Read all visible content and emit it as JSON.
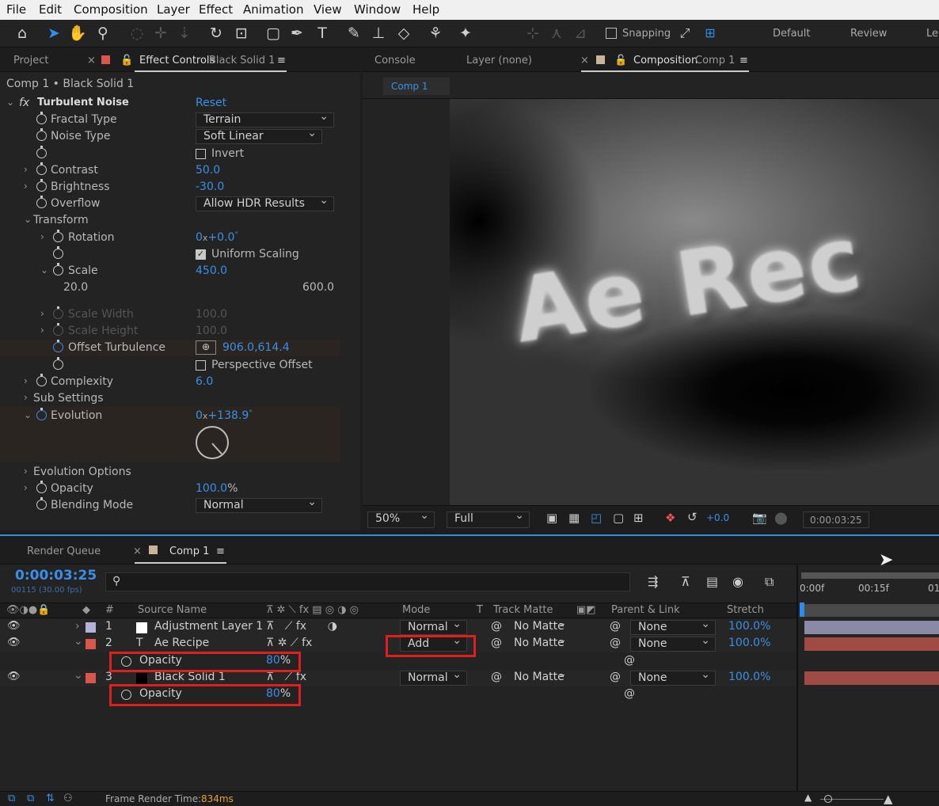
{
  "menu": [
    "File",
    "Edit",
    "Composition",
    "Layer",
    "Effect",
    "Animation",
    "View",
    "Window",
    "Help"
  ],
  "toolbar": {
    "snapping": "Snapping",
    "workspaces": [
      "Default",
      "Review",
      "Le"
    ]
  },
  "left_panel": {
    "tabs": {
      "project": "Project",
      "effect_controls": "Effect Controls",
      "layer": "Black Solid 1"
    },
    "breadcrumb": "Comp 1 • Black Solid 1",
    "effect": {
      "name": "Turbulent Noise",
      "reset": "Reset",
      "fx": "fx"
    },
    "props": {
      "fractal_type": {
        "label": "Fractal Type",
        "value": "Terrain"
      },
      "noise_type": {
        "label": "Noise Type",
        "value": "Soft Linear"
      },
      "invert": "Invert",
      "contrast": {
        "label": "Contrast",
        "value": "50.0"
      },
      "brightness": {
        "label": "Brightness",
        "value": "-30.0"
      },
      "overflow": {
        "label": "Overflow",
        "value": "Allow HDR Results"
      },
      "transform": "Transform",
      "rotation": {
        "label": "Rotation",
        "v1": "0",
        "v2": "+0.0"
      },
      "uniform_scaling": "Uniform Scaling",
      "scale": {
        "label": "Scale",
        "value": "450.0",
        "min": "20.0",
        "max": "600.0",
        "level": 0.74
      },
      "scale_width": {
        "label": "Scale Width",
        "value": "100.0"
      },
      "scale_height": {
        "label": "Scale Height",
        "value": "100.0"
      },
      "offset": {
        "label": "Offset Turbulence",
        "value": "906.0,614.4"
      },
      "perspective": "Perspective Offset",
      "complexity": {
        "label": "Complexity",
        "value": "6.0"
      },
      "sub_settings": "Sub Settings",
      "evolution": {
        "label": "Evolution",
        "v1": "0",
        "v2": "+138.9"
      },
      "evolution_options": "Evolution Options",
      "opacity": {
        "label": "Opacity",
        "value": "100.0",
        "unit": "%"
      },
      "blending": {
        "label": "Blending Mode",
        "value": "Normal"
      }
    }
  },
  "viewer": {
    "tabs": {
      "console": "Console",
      "layer": "Layer (none)",
      "composition": "Composition",
      "comp": "Comp 1"
    },
    "comp_tab": "Comp 1",
    "zoom": "50%",
    "resolution": "Full",
    "exposure": "+0.0",
    "timecode": "0:00:03:25"
  },
  "timeline": {
    "tabs": {
      "render_queue": "Render Queue",
      "comp": "Comp 1"
    },
    "timecode": "0:00:03:25",
    "frames": "00115 (30.00 fps)",
    "search_placeholder": "",
    "headers": {
      "num": "#",
      "source": "Source Name",
      "mode": "Mode",
      "t": "T",
      "track_matte": "Track Matte",
      "parent": "Parent & Link",
      "stretch": "Stretch"
    },
    "ruler": [
      "0:00f",
      "00:15f",
      "01"
    ],
    "layers": [
      {
        "num": "1",
        "name": "Adjustment Layer 1",
        "mode": "Normal",
        "matte": "No Matte",
        "parent": "None",
        "stretch": "100.0%",
        "color": "#b3b3d9"
      },
      {
        "num": "2",
        "name": "Ae Recipe",
        "mode": "Add",
        "matte": "No Matte",
        "parent": "None",
        "stretch": "100.0%",
        "color": "#d9574a"
      },
      {
        "num": "3",
        "name": "Black Solid 1",
        "mode": "Normal",
        "matte": "No Matte",
        "parent": "None",
        "stretch": "100.0%",
        "color": "#d9574a"
      }
    ],
    "opacity_rows": [
      {
        "label": "Opacity",
        "value": "80",
        "unit": "%"
      },
      {
        "label": "Opacity",
        "value": "80",
        "unit": "%"
      }
    ],
    "footer": {
      "label": "Frame Render Time:",
      "value": "834ms"
    }
  }
}
